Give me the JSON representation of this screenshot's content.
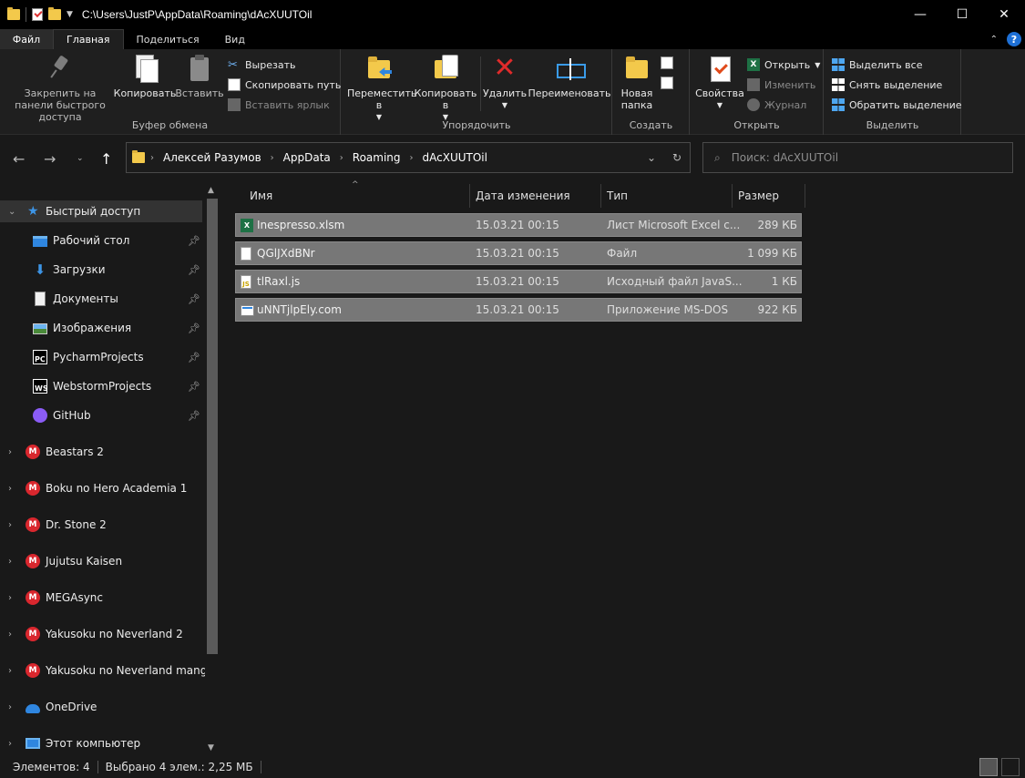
{
  "window": {
    "title": "C:\\Users\\JustP\\AppData\\Roaming\\dAcXUUTOil",
    "minimize": "—",
    "maximize": "☐",
    "close": "✕"
  },
  "tabs": [
    {
      "label": "Файл"
    },
    {
      "label": "Главная"
    },
    {
      "label": "Поделиться"
    },
    {
      "label": "Вид"
    }
  ],
  "ribbon": {
    "clipboard": {
      "group_label": "Буфер обмена",
      "pin_label": "Закрепить на панели быстрого доступа",
      "copy_label": "Копировать",
      "paste_label": "Вставить",
      "cut_label": "Вырезать",
      "copy_path_label": "Скопировать путь",
      "paste_shortcut_label": "Вставить ярлык"
    },
    "organize": {
      "group_label": "Упорядочить",
      "move_label": "Переместить в",
      "copy_to_label": "Копировать в",
      "delete_label": "Удалить",
      "rename_label": "Переименовать"
    },
    "create": {
      "group_label": "Создать",
      "new_folder_label": "Новая папка"
    },
    "open": {
      "group_label": "Открыть",
      "properties_label": "Свойства",
      "open_label": "Открыть",
      "edit_label": "Изменить",
      "history_label": "Журнал"
    },
    "select": {
      "group_label": "Выделить",
      "select_all_label": "Выделить все",
      "select_none_label": "Снять выделение",
      "invert_label": "Обратить выделение"
    }
  },
  "address": {
    "crumbs": [
      "Алексей Разумов",
      "AppData",
      "Roaming",
      "dAcXUUTOil"
    ],
    "search_placeholder": "Поиск: dAcXUUTOil"
  },
  "sidebar": {
    "items": [
      {
        "label": "Быстрый доступ",
        "icon": "star-icon"
      },
      {
        "label": "Рабочий стол",
        "icon": "desktop-icon"
      },
      {
        "label": "Загрузки",
        "icon": "download-icon"
      },
      {
        "label": "Документы",
        "icon": "documents-icon"
      },
      {
        "label": "Изображения",
        "icon": "pictures-icon"
      },
      {
        "label": "PycharmProjects",
        "icon": "pycharm-icon"
      },
      {
        "label": "WebstormProjects",
        "icon": "webstorm-icon"
      },
      {
        "label": "GitHub",
        "icon": "github-icon"
      },
      {
        "label": "Beastars 2",
        "icon": "mega-icon"
      },
      {
        "label": "Boku no Hero Academia 1",
        "icon": "mega-icon"
      },
      {
        "label": "Dr. Stone 2",
        "icon": "mega-icon"
      },
      {
        "label": "Jujutsu Kaisen",
        "icon": "mega-icon"
      },
      {
        "label": "MEGAsync",
        "icon": "mega-icon"
      },
      {
        "label": "Yakusoku no Neverland 2",
        "icon": "mega-icon"
      },
      {
        "label": "Yakusoku no Neverland manga",
        "icon": "mega-icon"
      },
      {
        "label": "OneDrive",
        "icon": "onedrive-icon"
      },
      {
        "label": "Этот компьютер",
        "icon": "computer-icon"
      }
    ]
  },
  "columns": {
    "name": "Имя",
    "date": "Дата изменения",
    "type": "Тип",
    "size": "Размер"
  },
  "files": [
    {
      "name": "Inespresso.xlsm",
      "date": "15.03.21 00:15",
      "type": "Лист Microsoft Excel с...",
      "size": "289 КБ"
    },
    {
      "name": "QGlJXdBNr",
      "date": "15.03.21 00:15",
      "type": "Файл",
      "size": "1 099 КБ"
    },
    {
      "name": "tlRaxl.js",
      "date": "15.03.21 00:15",
      "type": "Исходный файл JavaS...",
      "size": "1 КБ"
    },
    {
      "name": "uNNTjlpEly.com",
      "date": "15.03.21 00:15",
      "type": "Приложение MS-DOS",
      "size": "922 КБ"
    }
  ],
  "status": {
    "count": "Элементов: 4",
    "selected": "Выбрано 4 элем.: 2,25 МБ"
  }
}
